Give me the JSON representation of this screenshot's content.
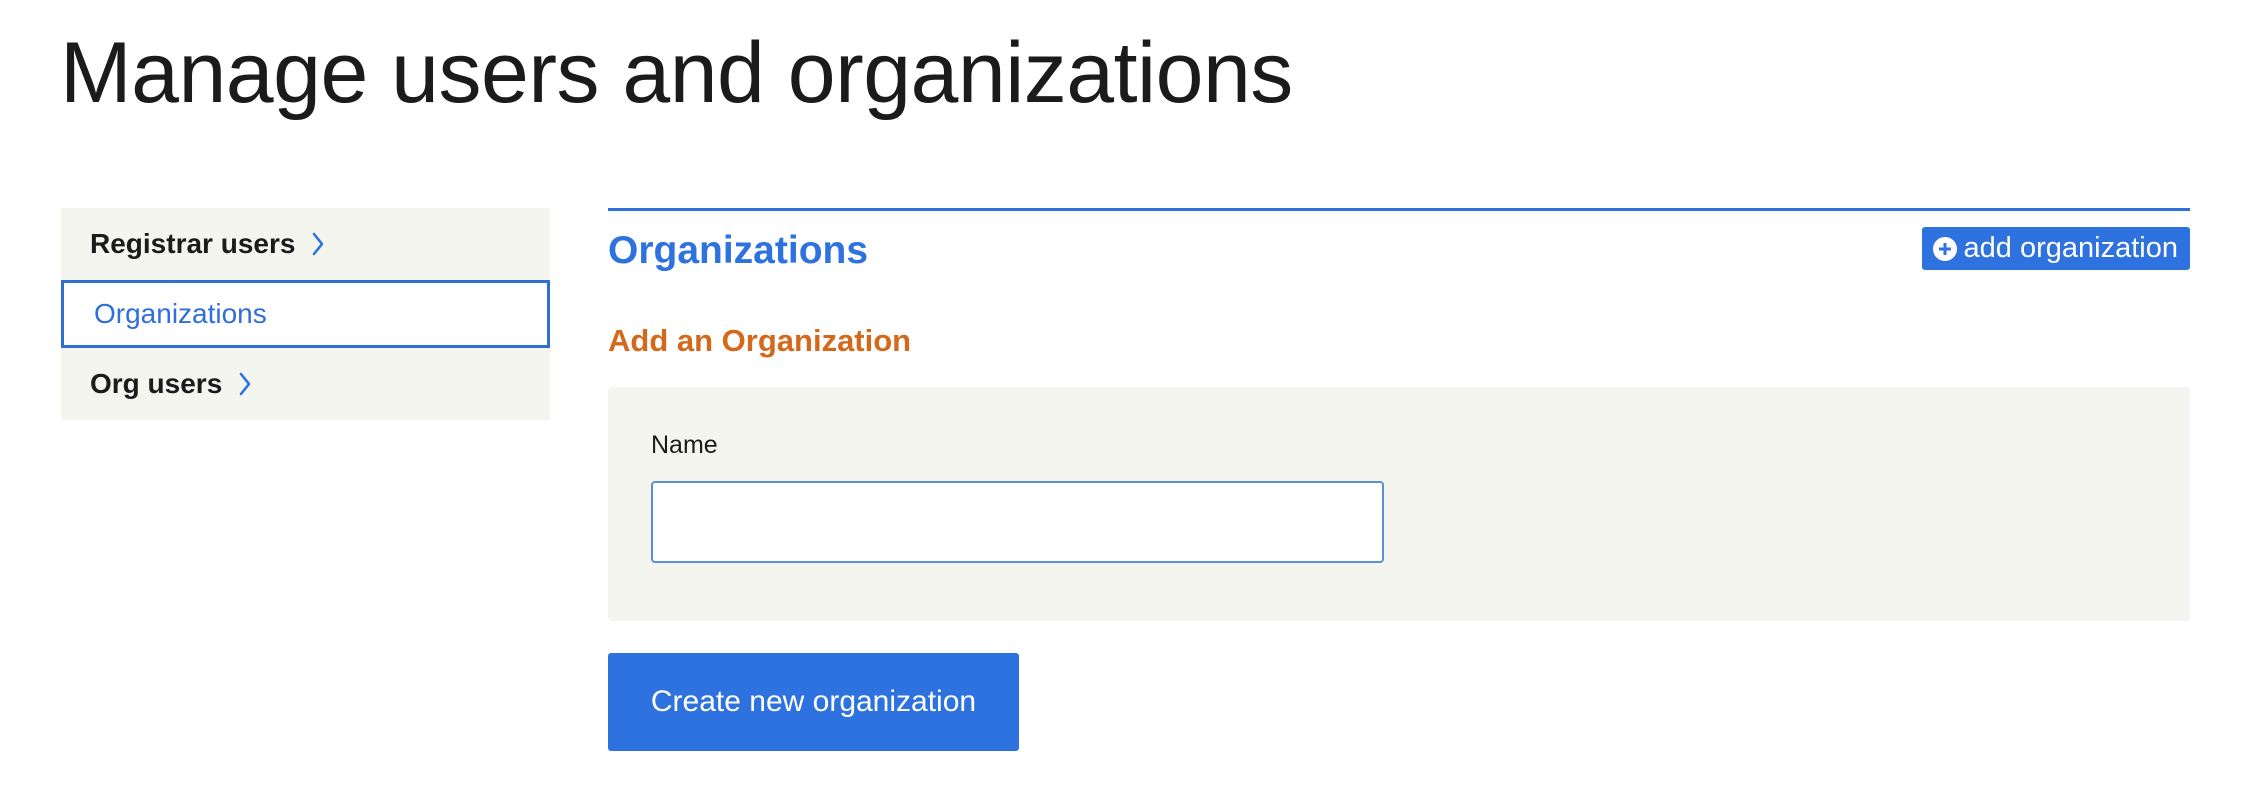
{
  "page": {
    "title": "Manage users and organizations"
  },
  "sidebar": {
    "items": [
      {
        "label": "Registrar users",
        "active": false,
        "icon": "chevron-right-icon"
      },
      {
        "label": "Organizations",
        "active": true
      },
      {
        "label": "Org users",
        "active": false,
        "icon": "chevron-right-icon"
      }
    ]
  },
  "main": {
    "section_title": "Organizations",
    "add_button": {
      "label": "add organization",
      "icon": "plus-circle-icon"
    },
    "form_title": "Add an Organization",
    "form": {
      "name_label": "Name",
      "name_value": "",
      "name_placeholder": ""
    },
    "submit_label": "Create new organization"
  },
  "colors": {
    "accent_blue": "#2e72e0",
    "form_title_orange": "#d4691c",
    "panel_background": "#f5f5f0",
    "text": "#1b1b1b"
  }
}
